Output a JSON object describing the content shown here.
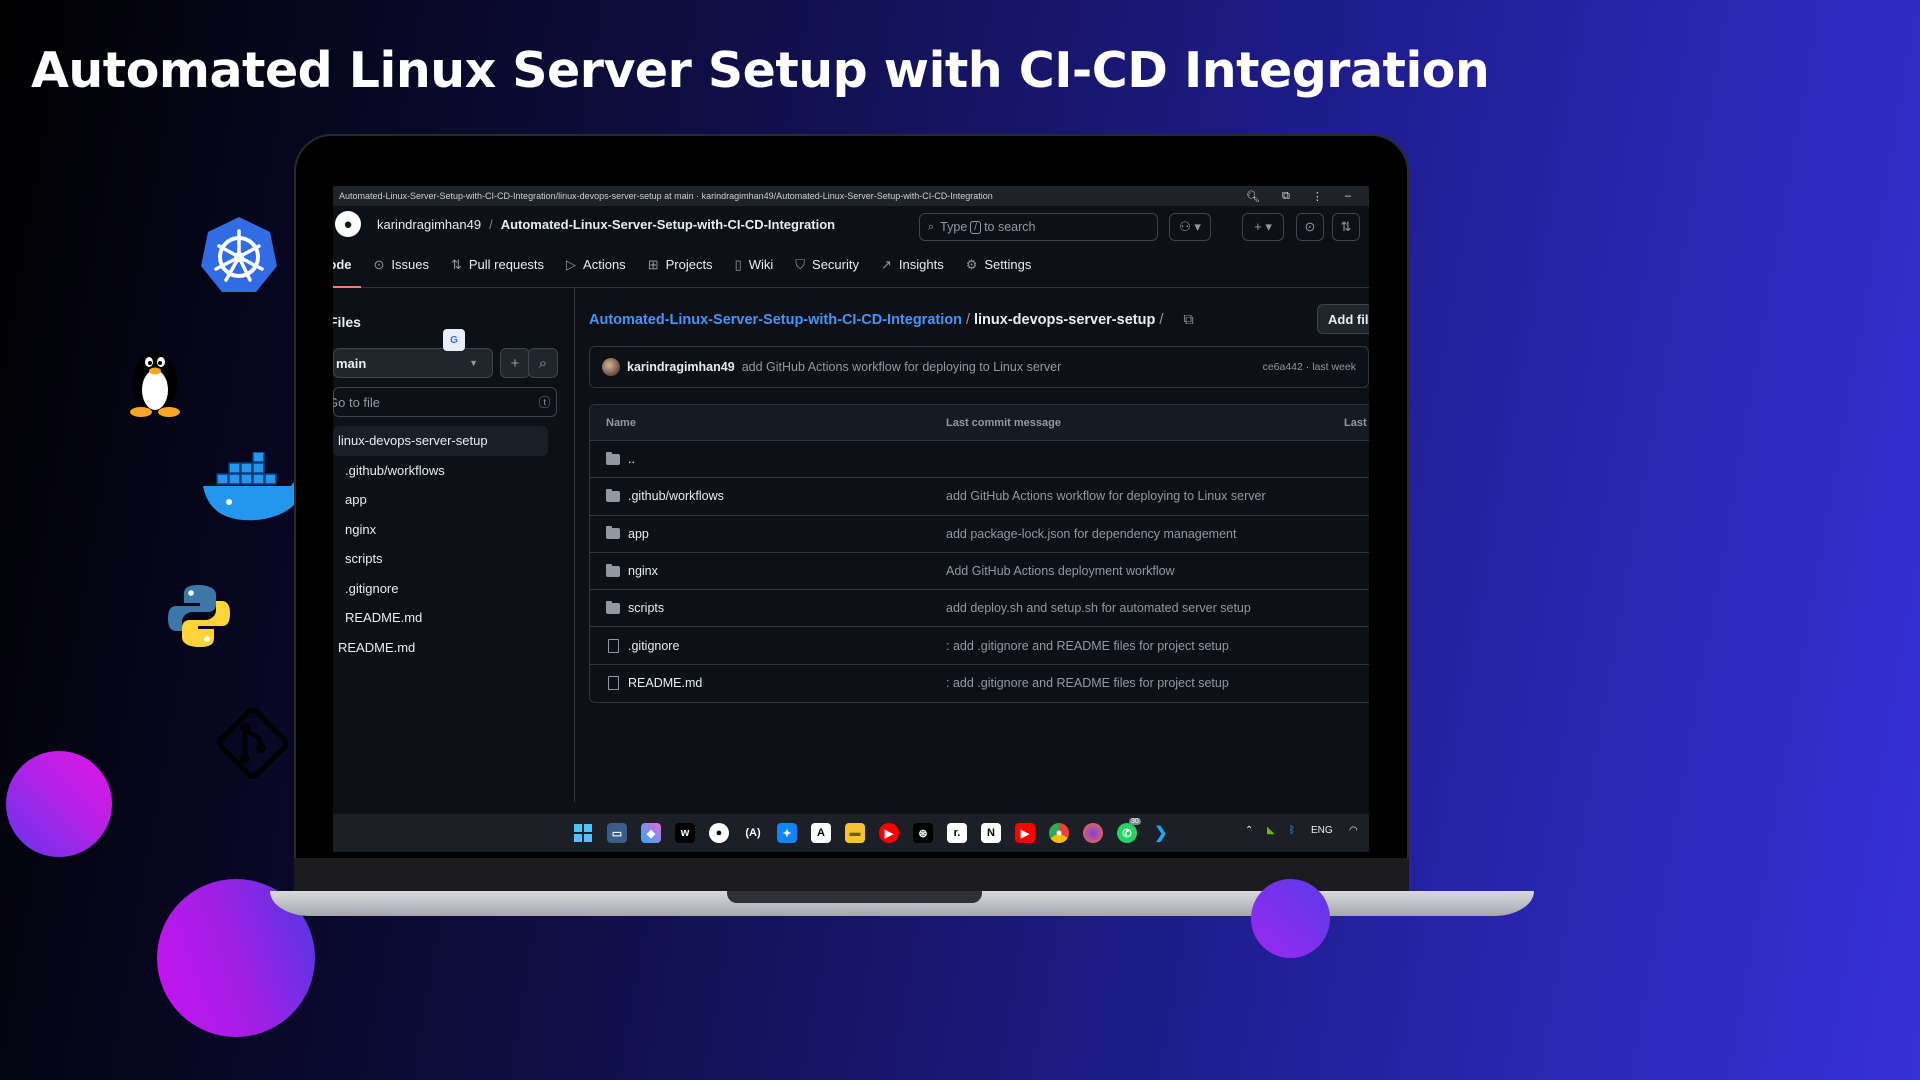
{
  "slide": {
    "title": "Automated Linux Server Setup with CI-CD Integration"
  },
  "decorative_icons": [
    "kubernetes-icon",
    "linux-tux-icon",
    "docker-icon",
    "python-icon",
    "git-icon"
  ],
  "colors": {
    "github_link": "#4493f8",
    "github_bg": "#0d1117",
    "tab_underline": "#f78166"
  },
  "browser": {
    "window_title": "Automated-Linux-Server-Setup-with-CI-CD-Integration/linux-devops-server-setup at main · karindragimhan49/Automated-Linux-Server-Setup-with-CI-CD-Integration"
  },
  "github": {
    "owner": "karindragimhan49",
    "repo": "Automated-Linux-Server-Setup-with-CI-CD-Integration",
    "search": {
      "type": "Type",
      "key": "/",
      "rest": "to search"
    },
    "tabs": [
      {
        "label": "Code",
        "icon": "code-icon"
      },
      {
        "label": "Issues",
        "icon": "issue-icon"
      },
      {
        "label": "Pull requests",
        "icon": "pull-request-icon"
      },
      {
        "label": "Actions",
        "icon": "actions-icon"
      },
      {
        "label": "Projects",
        "icon": "projects-icon"
      },
      {
        "label": "Wiki",
        "icon": "book-icon"
      },
      {
        "label": "Security",
        "icon": "shield-icon"
      },
      {
        "label": "Insights",
        "icon": "graph-icon"
      },
      {
        "label": "Settings",
        "icon": "gear-icon"
      }
    ],
    "sidebar": {
      "files_label": "Files",
      "branch": "main",
      "go_to_file": "Go to file",
      "go_to_file_key": "t",
      "tree": [
        {
          "label": "linux-devops-server-setup",
          "kind": "root"
        },
        {
          "label": ".github/workflows",
          "kind": "child"
        },
        {
          "label": "app",
          "kind": "child"
        },
        {
          "label": "nginx",
          "kind": "child"
        },
        {
          "label": "scripts",
          "kind": "child"
        },
        {
          "label": ".gitignore",
          "kind": "child"
        },
        {
          "label": "README.md",
          "kind": "child"
        },
        {
          "label": "README.md",
          "kind": "plain"
        }
      ]
    },
    "main": {
      "path_repo": "Automated-Linux-Server-Setup-with-CI-CD-Integration",
      "path_dir": "linux-devops-server-setup",
      "add_file": "Add file",
      "latest_commit": {
        "author": "karindragimhan49",
        "message": "add GitHub Actions workflow for deploying to Linux server",
        "hash": "ce6a442",
        "time": "last week"
      },
      "columns": {
        "name": "Name",
        "message": "Last commit message",
        "date": "Last commit date"
      },
      "rows": [
        {
          "name": "..",
          "type": "folder",
          "message": ""
        },
        {
          "name": ".github/workflows",
          "type": "folder",
          "message": "add GitHub Actions workflow for deploying to Linux server"
        },
        {
          "name": "app",
          "type": "folder",
          "message": "add package-lock.json for dependency management"
        },
        {
          "name": "nginx",
          "type": "folder",
          "message": "Add GitHub Actions deployment workflow"
        },
        {
          "name": "scripts",
          "type": "folder",
          "message": "add deploy.sh and setup.sh for automated server setup"
        },
        {
          "name": ".gitignore",
          "type": "file",
          "message": ": add .gitignore and README files for project setup"
        },
        {
          "name": "README.md",
          "type": "file",
          "message": ": add .gitignore and README files for project setup"
        }
      ]
    }
  },
  "taskbar": {
    "lang": "ENG",
    "whatsapp_badge": "30"
  }
}
